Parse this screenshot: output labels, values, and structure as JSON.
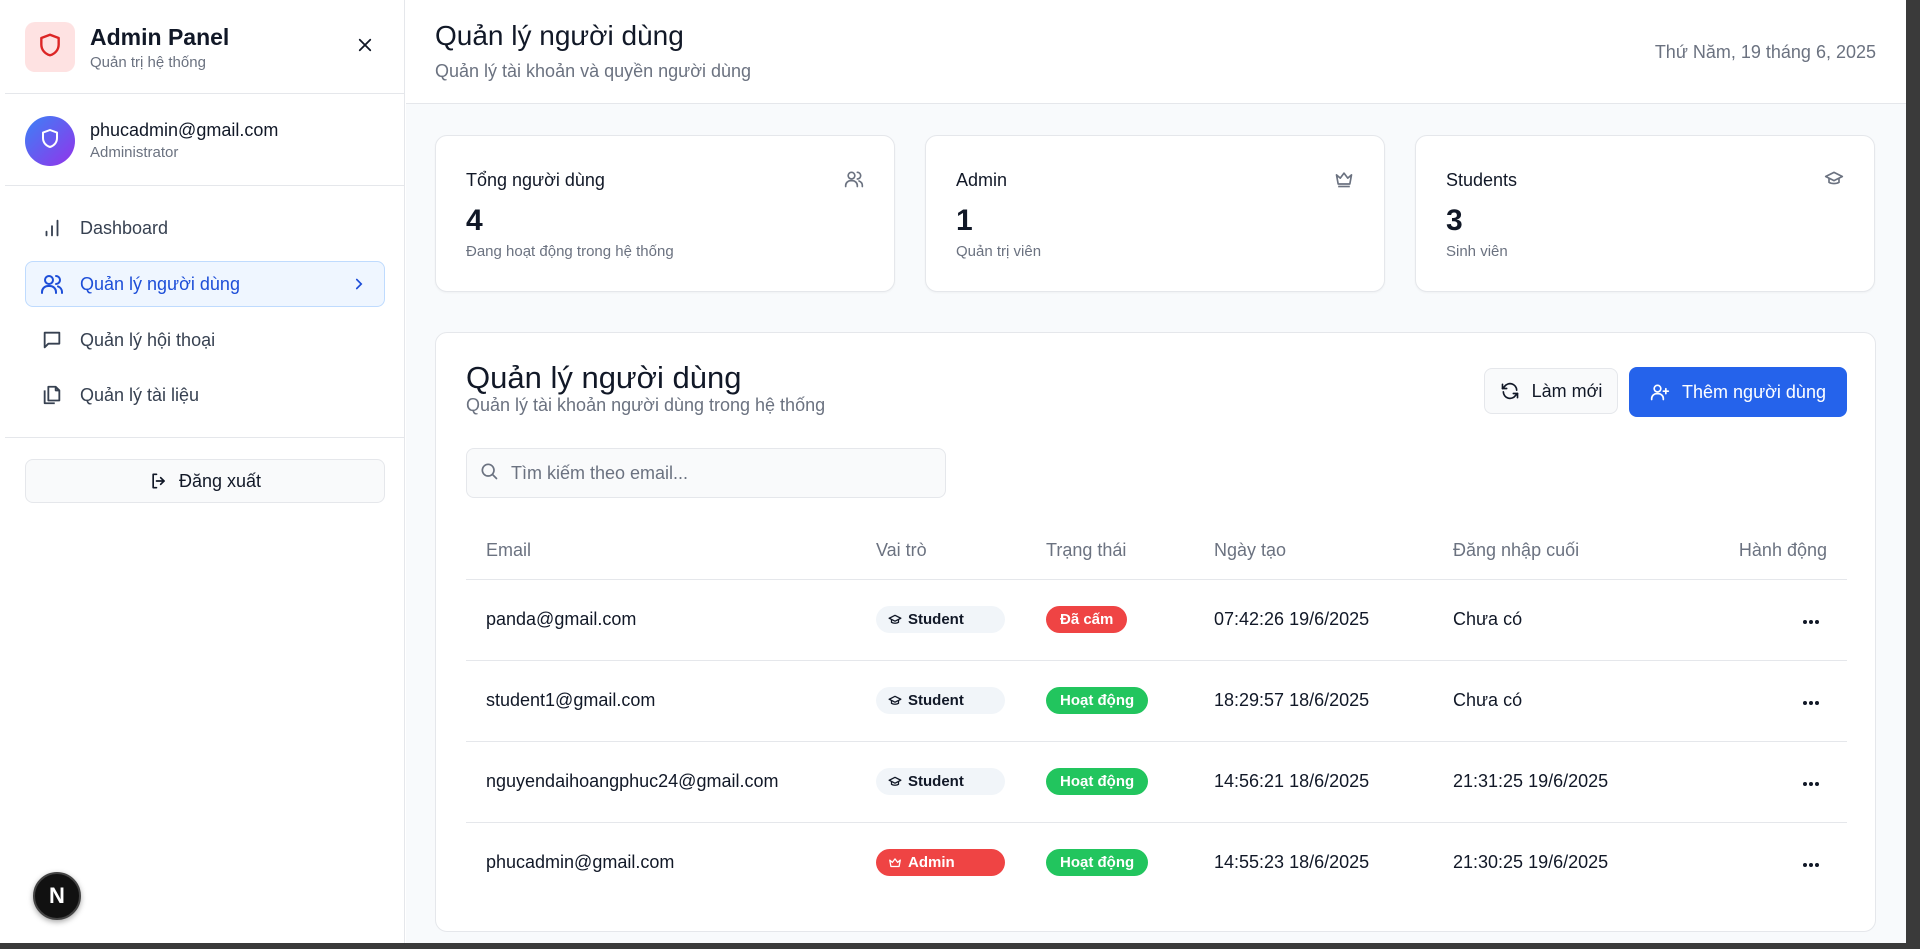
{
  "brand": {
    "title": "Admin Panel",
    "subtitle": "Quản trị hệ thống",
    "icon": "shield-icon",
    "color": "#dc2626"
  },
  "user": {
    "email": "phucadmin@gmail.com",
    "role": "Administrator"
  },
  "sidebar": {
    "items": [
      {
        "label": "Dashboard",
        "icon": "bar-chart-icon"
      },
      {
        "label": "Quản lý người dùng",
        "icon": "users-icon",
        "active": true
      },
      {
        "label": "Quản lý hội thoại",
        "icon": "message-square-icon"
      },
      {
        "label": "Quản lý tài liệu",
        "icon": "files-icon"
      }
    ],
    "logout_label": "Đăng xuất"
  },
  "header": {
    "title": "Quản lý người dùng",
    "subtitle": "Quản lý tài khoản và quyền người dùng",
    "date": "Thứ Năm, 19 tháng 6, 2025"
  },
  "stats": [
    {
      "label": "Tổng người dùng",
      "value": "4",
      "desc": "Đang hoạt động trong hệ thống",
      "icon": "users-icon"
    },
    {
      "label": "Admin",
      "value": "1",
      "desc": "Quản trị viên",
      "icon": "crown-icon"
    },
    {
      "label": "Students",
      "value": "3",
      "desc": "Sinh viên",
      "icon": "graduation-cap-icon"
    }
  ],
  "panel": {
    "title": "Quản lý người dùng",
    "subtitle": "Quản lý tài khoản người dùng trong hệ thống",
    "refresh_label": "Làm mới",
    "add_label": "Thêm người dùng",
    "search_placeholder": "Tìm kiếm theo email..."
  },
  "table": {
    "headers": [
      "Email",
      "Vai trò",
      "Trạng thái",
      "Ngày tạo",
      "Đăng nhập cuối",
      "Hành động"
    ],
    "rows": [
      {
        "email": "panda@gmail.com",
        "role": "Student",
        "status": "Đã cấm",
        "created": "07:42:26 19/6/2025",
        "last_login": "Chưa có"
      },
      {
        "email": "student1@gmail.com",
        "role": "Student",
        "status": "Hoạt động",
        "created": "18:29:57 18/6/2025",
        "last_login": "Chưa có"
      },
      {
        "email": "nguyendaihoangphuc24@gmail.com",
        "role": "Student",
        "status": "Hoạt động",
        "created": "14:56:21 18/6/2025",
        "last_login": "21:31:25 19/6/2025"
      },
      {
        "email": "phucadmin@gmail.com",
        "role": "Admin",
        "status": "Hoạt động",
        "created": "14:55:23 18/6/2025",
        "last_login": "21:30:25 19/6/2025"
      }
    ]
  },
  "colors": {
    "primary": "#2563eb",
    "banned": "#ef4444",
    "active": "#22c55e",
    "admin_badge": "#ef4444"
  },
  "dev_badge": "N"
}
